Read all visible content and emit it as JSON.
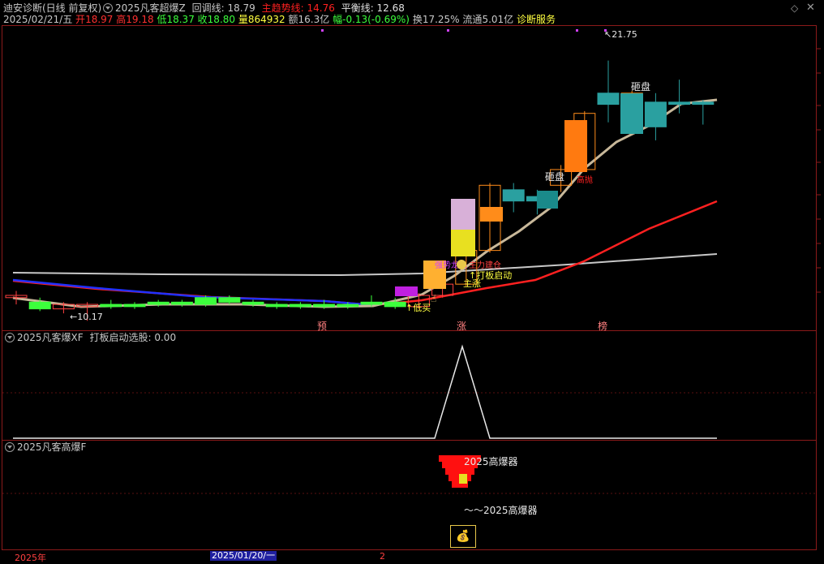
{
  "window": {
    "title": "迪安诊断(日线 前复权)",
    "formula_name": "2025凡客超爆Z",
    "controls": {
      "settings_icon": "diamond-icon",
      "close_icon": "close-icon"
    }
  },
  "main_header": {
    "huitiao": "回调线: 18.79",
    "zhuqushi": "主趋势线: 14.76",
    "pingheng": "平衡线: 12.68"
  },
  "quote": {
    "date": "2025/02/21/五",
    "open_label": "开",
    "open": "18.97",
    "high_label": "高",
    "high": "19.18",
    "low_label": "低",
    "low": "18.37",
    "close_label": "收",
    "close": "18.80",
    "vol_label": "量",
    "vol": "864932",
    "amount_label": "额",
    "amount": "16.3亿",
    "change_label": "幅",
    "change": "-0.13(-0.69%)",
    "turnover_label": "换",
    "turnover": "17.25%",
    "float_label": "流通",
    "float": "5.01亿",
    "service": "诊断服务"
  },
  "chart_labels": {
    "high_price": "21.75",
    "low_price": "10.17",
    "zapan1": "砸盘",
    "zapan2": "砸盘",
    "yu": "预",
    "zhang": "涨",
    "bang": "榜",
    "dibuy": "低买",
    "daban": "打板启动",
    "zhuzhang": "主涨",
    "qianglong": "强势龙头",
    "zhuqi": "主力建仓",
    "redlabel": "高抛"
  },
  "sub1": {
    "name": "2025凡客爆XF",
    "value_text": "打板启动选股: 0.00"
  },
  "sub2": {
    "name": "2025凡客高爆F",
    "label1": "2025高爆器",
    "label2": "～～2025高爆器"
  },
  "bottom_axis": {
    "year": "2025年",
    "date": "2025/01/20/一",
    "tick": "2"
  },
  "chart_data": {
    "type": "candlestick",
    "price_range": [
      10,
      23
    ],
    "candles": [
      {
        "o": 11.2,
        "h": 11.5,
        "l": 10.9,
        "c": 11.3,
        "up": true
      },
      {
        "o": 11.0,
        "h": 11.2,
        "l": 10.6,
        "c": 10.7,
        "up": false
      },
      {
        "o": 10.7,
        "h": 11.0,
        "l": 10.5,
        "c": 10.9,
        "up": true
      },
      {
        "o": 10.8,
        "h": 11.0,
        "l": 10.17,
        "c": 10.9,
        "up": true
      },
      {
        "o": 10.9,
        "h": 11.1,
        "l": 10.7,
        "c": 10.8,
        "up": false
      },
      {
        "o": 10.8,
        "h": 11.0,
        "l": 10.7,
        "c": 10.9,
        "up": false
      },
      {
        "o": 10.9,
        "h": 11.1,
        "l": 10.8,
        "c": 11.0,
        "up": false
      },
      {
        "o": 11.0,
        "h": 11.1,
        "l": 10.8,
        "c": 10.9,
        "up": false
      },
      {
        "o": 10.9,
        "h": 11.3,
        "l": 10.8,
        "c": 11.2,
        "up": false
      },
      {
        "o": 11.2,
        "h": 11.3,
        "l": 10.9,
        "c": 11.0,
        "up": false
      },
      {
        "o": 11.0,
        "h": 11.1,
        "l": 10.8,
        "c": 10.9,
        "up": false
      },
      {
        "o": 10.9,
        "h": 11.0,
        "l": 10.7,
        "c": 10.8,
        "up": false
      },
      {
        "o": 10.8,
        "h": 11.0,
        "l": 10.7,
        "c": 10.9,
        "up": false
      },
      {
        "o": 10.9,
        "h": 11.1,
        "l": 10.7,
        "c": 10.8,
        "up": false
      },
      {
        "o": 10.8,
        "h": 11.0,
        "l": 10.7,
        "c": 10.9,
        "up": false
      },
      {
        "o": 10.9,
        "h": 11.3,
        "l": 10.8,
        "c": 11.0,
        "up": false
      },
      {
        "o": 11.0,
        "h": 11.2,
        "l": 10.7,
        "c": 10.8,
        "up": false
      },
      {
        "o": 10.8,
        "h": 11.4,
        "l": 10.7,
        "c": 11.3,
        "up": true
      },
      {
        "o": 11.3,
        "h": 11.9,
        "l": 11.2,
        "c": 11.8,
        "up": true
      },
      {
        "o": 11.8,
        "h": 13.4,
        "l": 11.7,
        "c": 13.3,
        "up": true
      },
      {
        "o": 13.3,
        "h": 16.3,
        "l": 13.2,
        "c": 16.2,
        "up": true
      },
      {
        "o": 15.5,
        "h": 16.3,
        "l": 15.0,
        "c": 16.0,
        "up": false
      },
      {
        "o": 15.5,
        "h": 16.0,
        "l": 14.9,
        "c": 15.7,
        "up": false
      },
      {
        "o": 16.2,
        "h": 17.1,
        "l": 15.9,
        "c": 16.9,
        "up": true
      },
      {
        "o": 16.9,
        "h": 19.5,
        "l": 16.8,
        "c": 19.4,
        "up": true
      },
      {
        "o": 19.8,
        "h": 21.75,
        "l": 19.0,
        "c": 20.3,
        "up": false
      },
      {
        "o": 18.8,
        "h": 20.4,
        "l": 18.7,
        "c": 20.3,
        "up": true
      },
      {
        "o": 19.9,
        "h": 20.3,
        "l": 18.2,
        "c": 18.8,
        "up": false
      },
      {
        "o": 19.9,
        "h": 20.9,
        "l": 19.4,
        "c": 19.8,
        "up": false
      },
      {
        "o": 19.8,
        "h": 20.0,
        "l": 18.9,
        "c": 19.9,
        "up": false
      }
    ]
  }
}
